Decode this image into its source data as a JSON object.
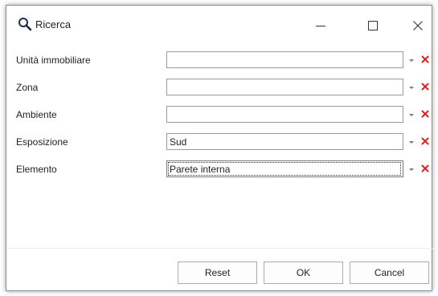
{
  "window": {
    "title": "Ricerca",
    "title_icon": "magnifier-icon",
    "controls": [
      "minimize-icon",
      "maximize-icon",
      "close-icon"
    ]
  },
  "form": {
    "rows": [
      {
        "label": "Unità immobiliare",
        "value": ""
      },
      {
        "label": "Zona",
        "value": ""
      },
      {
        "label": "Ambiente",
        "value": ""
      },
      {
        "label": "Esposizione",
        "value": "Sud"
      },
      {
        "label": "Elemento",
        "value": "Parete interna"
      }
    ],
    "dropdown_icon": "chevron-down-icon",
    "clear_icon": "clear-x-icon",
    "clear_color": "#e02020"
  },
  "buttons": {
    "reset": "Reset",
    "ok": "OK",
    "cancel": "Cancel"
  }
}
